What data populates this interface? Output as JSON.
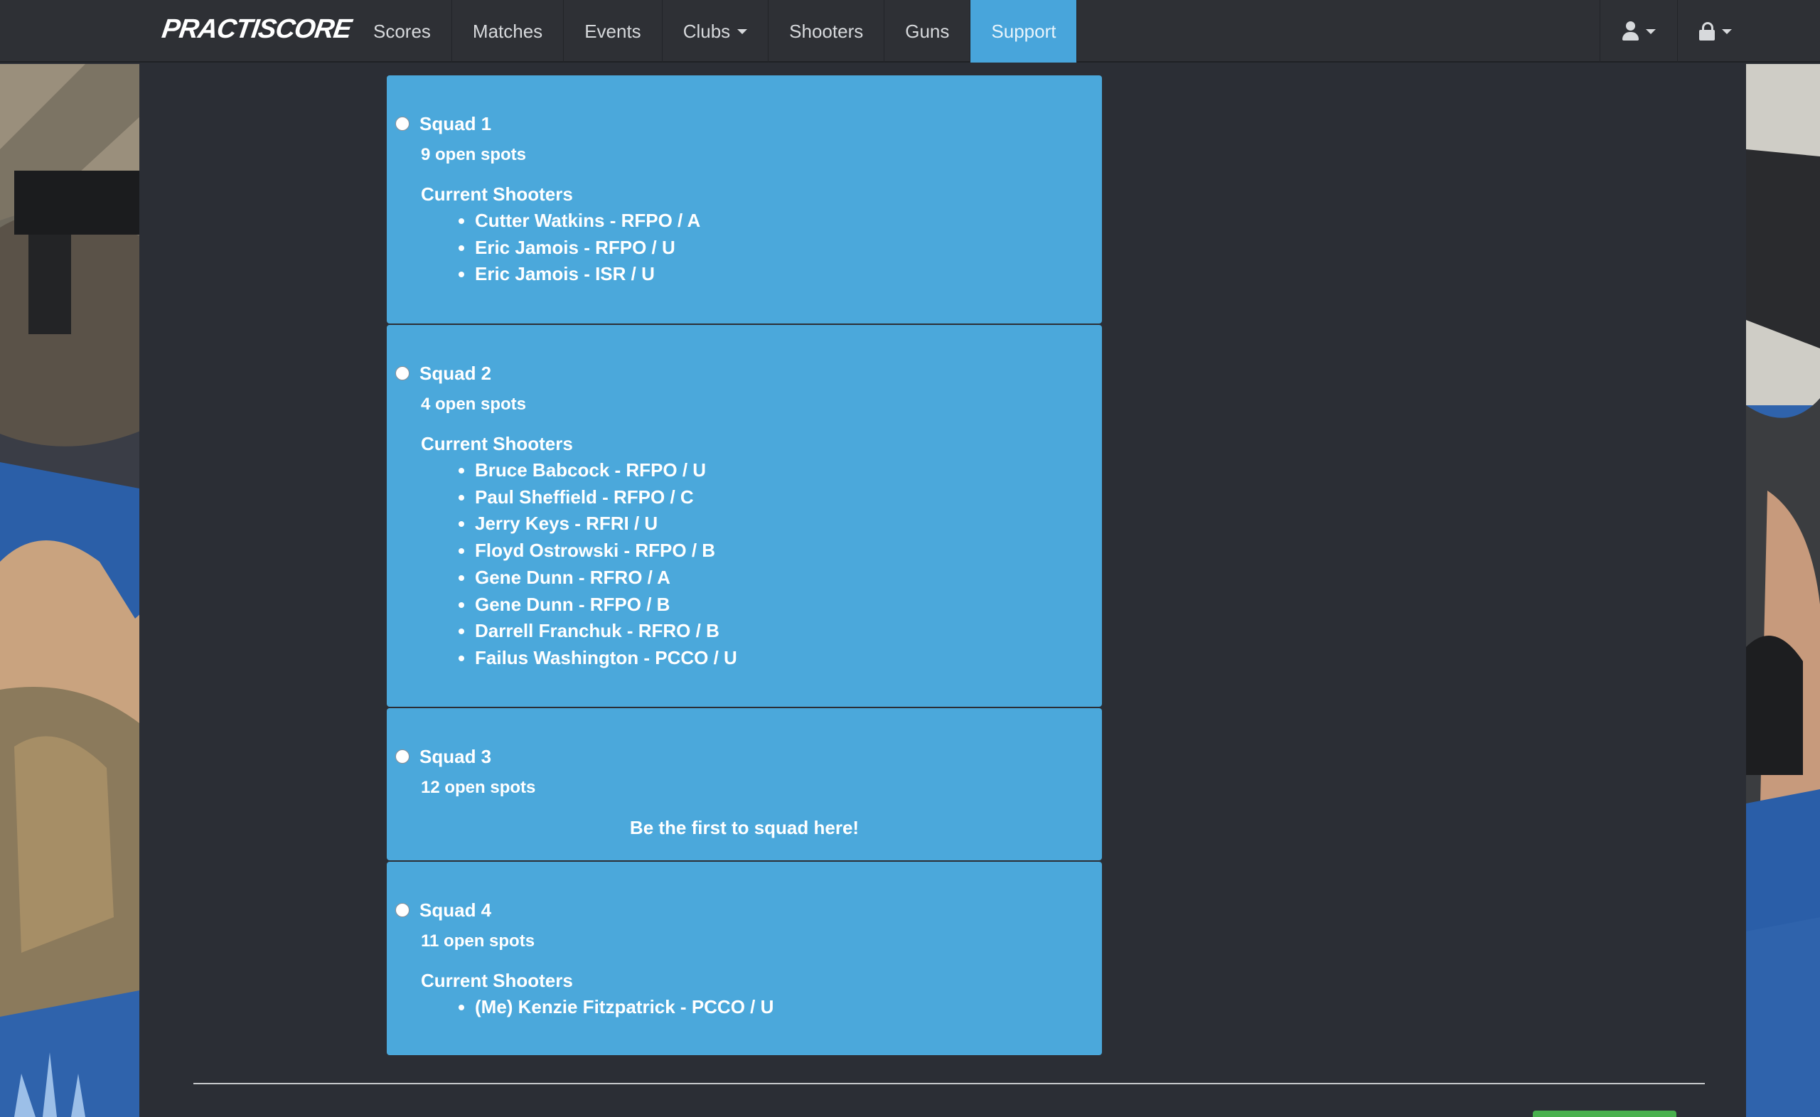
{
  "brand": "PRACTISCORE",
  "nav": {
    "items": [
      {
        "label": "Scores",
        "active": false,
        "dropdown": false
      },
      {
        "label": "Matches",
        "active": false,
        "dropdown": false
      },
      {
        "label": "Events",
        "active": false,
        "dropdown": false
      },
      {
        "label": "Clubs",
        "active": false,
        "dropdown": true
      },
      {
        "label": "Shooters",
        "active": false,
        "dropdown": false
      },
      {
        "label": "Guns",
        "active": false,
        "dropdown": false
      },
      {
        "label": "Support",
        "active": true,
        "dropdown": false
      }
    ],
    "right_icons": [
      "user-icon",
      "lock-icon"
    ]
  },
  "squads": [
    {
      "name": "Squad 1",
      "open_spots": "9 open spots",
      "shooters_title": "Current Shooters",
      "shooters": [
        "Cutter Watkins - RFPO / A",
        "Eric Jamois - RFPO / U",
        "Eric Jamois - ISR / U"
      ]
    },
    {
      "name": "Squad 2",
      "open_spots": "4 open spots",
      "shooters_title": "Current Shooters",
      "shooters": [
        "Bruce Babcock - RFPO / U",
        "Paul Sheffield - RFPO / C",
        "Jerry Keys - RFRI / U",
        "Floyd Ostrowski - RFPO / B",
        "Gene Dunn - RFRO / A",
        "Gene Dunn - RFPO / B",
        "Darrell Franchuk - RFRO / B",
        "Failus Washington - PCCO / U"
      ]
    },
    {
      "name": "Squad 3",
      "open_spots": "12 open spots",
      "empty_message": "Be the first to squad here!"
    },
    {
      "name": "Squad 4",
      "open_spots": "11 open spots",
      "shooters_title": "Current Shooters",
      "shooters": [
        "(Me) Kenzie Fitzpatrick - PCCO / U"
      ]
    }
  ],
  "colors": {
    "navbar_bg": "#2e3035",
    "active_tab": "#48a5db",
    "squad_card": "#4ba8db",
    "page_bg": "#2b2e35",
    "button_green": "#49b04d"
  }
}
